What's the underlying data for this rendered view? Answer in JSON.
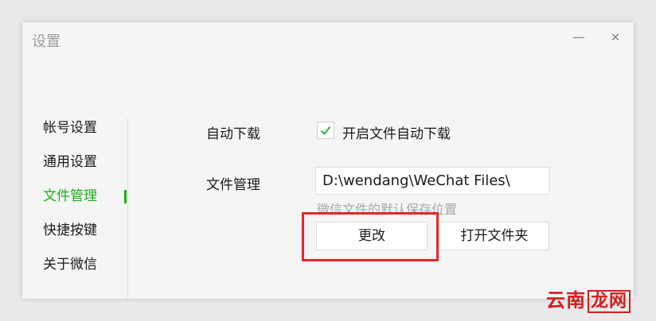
{
  "window": {
    "title": "设置",
    "minimize_glyph": "—",
    "close_glyph": "✕"
  },
  "sidebar": {
    "items": [
      {
        "label": "帐号设置",
        "active": false
      },
      {
        "label": "通用设置",
        "active": false
      },
      {
        "label": "文件管理",
        "active": true
      },
      {
        "label": "快捷按键",
        "active": false
      },
      {
        "label": "关于微信",
        "active": false
      }
    ]
  },
  "file_settings": {
    "auto_download_label": "自动下载",
    "auto_download_checked": true,
    "auto_download_option": "开启文件自动下载",
    "file_manage_label": "文件管理",
    "path_value": "D:\\wendang\\WeChat Files\\",
    "path_hint": "微信文件的默认保存位置",
    "change_button": "更改",
    "open_folder_button": "打开文件夹"
  },
  "watermark": {
    "text": "云南",
    "boxed": "龙网"
  },
  "colors": {
    "accent": "#1aad19",
    "highlight": "#e0292b",
    "watermark": "#d21e1e"
  },
  "icons": {
    "check": "check-icon",
    "minimize": "minimize-icon",
    "close": "close-icon"
  }
}
